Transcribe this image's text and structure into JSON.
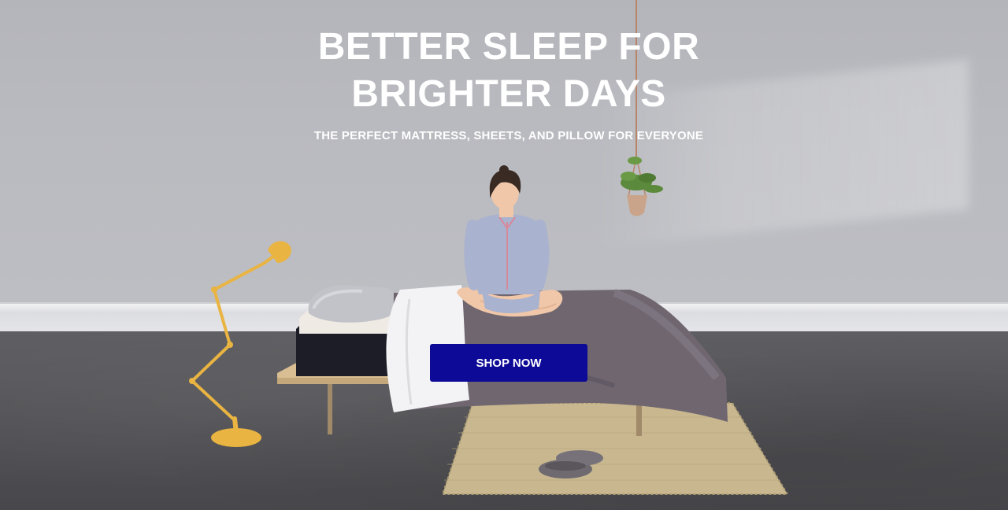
{
  "hero": {
    "headline_line1": "BETTER SLEEP FOR",
    "headline_line2": "BRIGHTER DAYS",
    "subheadline": "THE PERFECT MATTRESS, SHEETS, AND PILLOW FOR EVERYONE",
    "cta_label": "SHOP NOW"
  },
  "colors": {
    "cta_background": "#0c0a96",
    "text": "#ffffff",
    "wall": "#b9babf",
    "floor": "#525256",
    "lamp": "#e9b441",
    "duvet": "#6f6670"
  },
  "scene": {
    "elements": [
      "wall",
      "baseboard",
      "floor",
      "bed",
      "mattress",
      "pillow",
      "duvet",
      "woman",
      "floor-lamp",
      "hanging-plant",
      "rug",
      "slippers"
    ]
  }
}
